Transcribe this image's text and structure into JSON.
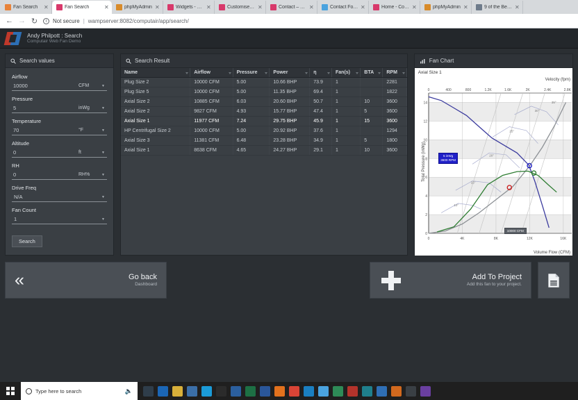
{
  "browser": {
    "tabs": [
      {
        "title": "Fan Search",
        "favicon": "#e8833a",
        "active": false
      },
      {
        "title": "Fan Search",
        "favicon": "#d8396b",
        "active": true
      },
      {
        "title": "phpMyAdmin",
        "favicon": "#d88b2a",
        "active": false
      },
      {
        "title": "Widgets - Fan S…",
        "favicon": "#d8396b",
        "active": false
      },
      {
        "title": "Customise Fan",
        "favicon": "#d8396b",
        "active": false
      },
      {
        "title": "Contact – Fan …",
        "favicon": "#d8396b",
        "active": false
      },
      {
        "title": "Contact Form —",
        "favicon": "#4aa3df",
        "active": false
      },
      {
        "title": "Home - Compu…",
        "favicon": "#d8396b",
        "active": false
      },
      {
        "title": "phpMyAdmin",
        "favicon": "#d88b2a",
        "active": false
      },
      {
        "title": "9 of the Best F…",
        "favicon": "#6e7b8b",
        "active": false
      }
    ],
    "nav": {
      "back": "←",
      "forward": "→",
      "reload": "↻"
    },
    "security_label": "Not secure",
    "security_icon": "info-icon",
    "url": "wampserver:8082/computair/app/search/"
  },
  "app_header": {
    "title": "Andy Philpott : Search",
    "subtitle": "Computair Web Fan Demo",
    "logo": "computair-logo"
  },
  "sidebar": {
    "panel_title": "Search values",
    "panel_icon": "search-icon",
    "fields": [
      {
        "label": "Airflow",
        "value": "10000",
        "unit": "CFM",
        "type": "input"
      },
      {
        "label": "Pressure",
        "value": "5",
        "unit": "inWg",
        "type": "input"
      },
      {
        "label": "Temperature",
        "value": "70",
        "unit": "°F",
        "type": "input"
      },
      {
        "label": "Altitude",
        "value": "0",
        "unit": "ft",
        "type": "input"
      },
      {
        "label": "RH",
        "value": "0",
        "unit": "RH%",
        "type": "input"
      },
      {
        "label": "Drive Freq",
        "value": "N/A",
        "unit": "",
        "type": "select"
      },
      {
        "label": "Fan Count",
        "value": "1",
        "unit": "",
        "type": "select"
      }
    ],
    "search_button": "Search"
  },
  "results": {
    "panel_title": "Search Result",
    "panel_icon": "search-icon",
    "columns": [
      "Name",
      "Airflow",
      "Pressure",
      "Power",
      "η",
      "Fan(s)",
      "BTA",
      "RPM"
    ],
    "rows": [
      {
        "cells": [
          "Plug Size 2",
          "10000 CFM",
          "5.00",
          "10.66 BHP",
          "73.9",
          "1",
          "",
          "2281"
        ],
        "selected": false
      },
      {
        "cells": [
          "Plug Size 5",
          "10000 CFM",
          "5.00",
          "11.35 BHP",
          "69.4",
          "1",
          "",
          "1822"
        ],
        "selected": false
      },
      {
        "cells": [
          "Axial Size 2",
          "10885 CFM",
          "6.03",
          "20.60 BHP",
          "50.7",
          "1",
          "10",
          "3600"
        ],
        "selected": false
      },
      {
        "cells": [
          "Axial Size 2",
          "9827 CFM",
          "4.93",
          "15.77 BHP",
          "47.4",
          "1",
          "5",
          "3600"
        ],
        "selected": false
      },
      {
        "cells": [
          "Axial Size 1",
          "11977 CFM",
          "7.24",
          "29.75 BHP",
          "45.9",
          "1",
          "15",
          "3600"
        ],
        "selected": true
      },
      {
        "cells": [
          "HP Centrifugal Size 2",
          "10000 CFM",
          "5.00",
          "20.92 BHP",
          "37.6",
          "1",
          "",
          "1294"
        ],
        "selected": false
      },
      {
        "cells": [
          "Axial Size 3",
          "11381 CFM",
          "6.48",
          "23.28 BHP",
          "34.9",
          "1",
          "5",
          "1800"
        ],
        "selected": false
      },
      {
        "cells": [
          "Axial Size 1",
          "8638 CFM",
          "4.65",
          "24.27 BHP",
          "29.1",
          "1",
          "10",
          "3600"
        ],
        "selected": false
      }
    ]
  },
  "chart_panel": {
    "panel_title": "Fan Chart",
    "panel_icon": "chart-icon"
  },
  "chart_data": {
    "type": "line",
    "title": "Axial Size 1",
    "xlabel": "Volume Flow (CFM)",
    "ylabel": "Total Pressure (inWg)",
    "top_axis_label": "Velocity (fpm)",
    "xlim": [
      0,
      17000
    ],
    "ylim": [
      0,
      15
    ],
    "x_ticks": [
      "0",
      "4K",
      "8K",
      "12K",
      "16K"
    ],
    "x_tick_values": [
      0,
      4000,
      8000,
      12000,
      16000
    ],
    "top_ticks": [
      "0",
      "400",
      "800",
      "1.2K",
      "1.6K",
      "2K",
      "2.4K",
      "2.8K"
    ],
    "top_tick_values": [
      0,
      400,
      800,
      1200,
      1600,
      2000,
      2400,
      2800
    ],
    "y_ticks": [
      "0",
      "2",
      "4",
      "6",
      "8",
      "10",
      "12",
      "14"
    ],
    "y_tick_values": [
      0,
      2,
      4,
      6,
      8,
      10,
      12,
      14
    ],
    "grid": true,
    "legend": "none",
    "annotations": [
      {
        "name": "operating-point-badge",
        "text_line1": "5 inWg",
        "text_line2": "3600 RPM",
        "color": "#2020c8"
      },
      {
        "name": "flow-badge",
        "text": "10000 CFM",
        "color": "#5a5f66"
      }
    ],
    "series": [
      {
        "name": "Fan curve (selected)",
        "color": "#3b3b9e",
        "points": [
          [
            0,
            14.6
          ],
          [
            1500,
            14.2
          ],
          [
            3000,
            13.4
          ],
          [
            4500,
            12.6
          ],
          [
            6000,
            11.4
          ],
          [
            7500,
            10.2
          ],
          [
            9000,
            9.4
          ],
          [
            10500,
            8.6
          ],
          [
            11900,
            7.3
          ],
          [
            12600,
            5.6
          ],
          [
            13500,
            3.0
          ],
          [
            14300,
            0.6
          ]
        ]
      },
      {
        "name": "System curve",
        "color": "#8d9196",
        "points": [
          [
            0,
            0
          ],
          [
            2000,
            0.25
          ],
          [
            4000,
            1.0
          ],
          [
            6000,
            2.2
          ],
          [
            8000,
            3.6
          ],
          [
            10000,
            5.0
          ],
          [
            12000,
            7.2
          ],
          [
            13500,
            9.2
          ],
          [
            15000,
            11.6
          ],
          [
            16300,
            14.0
          ]
        ]
      },
      {
        "name": "Efficiency curve",
        "color": "#2e7d32",
        "points": [
          [
            1000,
            0.15
          ],
          [
            3000,
            0.7
          ],
          [
            5000,
            2.6
          ],
          [
            7000,
            5.2
          ],
          [
            8800,
            6.2
          ],
          [
            10500,
            6.6
          ],
          [
            11800,
            6.65
          ],
          [
            13000,
            6.2
          ],
          [
            14200,
            5.2
          ],
          [
            15200,
            4.4
          ]
        ]
      }
    ],
    "markers": [
      {
        "name": "duty-point-blue",
        "x": 11977,
        "y": 7.24,
        "color": "#2020c8"
      },
      {
        "name": "duty-point-green",
        "x": 12500,
        "y": 6.45,
        "color": "#2e7d32"
      },
      {
        "name": "duty-point-red",
        "x": 9600,
        "y": 4.9,
        "color": "#cc2222"
      }
    ],
    "blade_angle_labels": [
      "10°",
      "15°",
      "20°",
      "25°",
      "30°",
      "35°"
    ]
  },
  "actions": {
    "go_back": {
      "title": "Go back",
      "subtitle": "Dashboard",
      "icon": "double-chevron-left-icon"
    },
    "add_to_project": {
      "title": "Add To Project",
      "subtitle": "Add this fan to your project.",
      "icon": "plus-icon"
    },
    "document": {
      "icon": "document-icon"
    }
  },
  "taskbar": {
    "start_icon": "windows-start-icon",
    "search_placeholder": "Type here to search",
    "search_icon": "circle-icon",
    "mic_icon": "microphone-icon",
    "pinned": [
      {
        "name": "task-view-icon",
        "color": "#2f3d4a"
      },
      {
        "name": "outlook-icon",
        "color": "#1b66b5"
      },
      {
        "name": "explorer-icon",
        "color": "#d9b03a"
      },
      {
        "name": "folder-icon",
        "color": "#3b6fa8"
      },
      {
        "name": "skype-icon",
        "color": "#1b9bd8"
      },
      {
        "name": "terminal-icon",
        "color": "#2b2b2b"
      },
      {
        "name": "photoshop-icon",
        "color": "#2b5f9e"
      },
      {
        "name": "excel-icon",
        "color": "#1d7044"
      },
      {
        "name": "word-icon",
        "color": "#2a5699"
      },
      {
        "name": "firefox-icon",
        "color": "#e2711d"
      },
      {
        "name": "chrome-icon",
        "color": "#d94436"
      },
      {
        "name": "edge-icon",
        "color": "#1a7fc1"
      },
      {
        "name": "browser2-icon",
        "color": "#4aa3df"
      },
      {
        "name": "app-green-icon",
        "color": "#2e8b57"
      },
      {
        "name": "app-red-icon",
        "color": "#b4332b"
      },
      {
        "name": "app-teal-icon",
        "color": "#1f7f8c"
      },
      {
        "name": "app-blue-icon",
        "color": "#2f6fb5"
      },
      {
        "name": "app-orange-icon",
        "color": "#d2691e"
      },
      {
        "name": "app-dark-icon",
        "color": "#3a3f44"
      },
      {
        "name": "app-purple-icon",
        "color": "#6a3fa0"
      }
    ]
  }
}
